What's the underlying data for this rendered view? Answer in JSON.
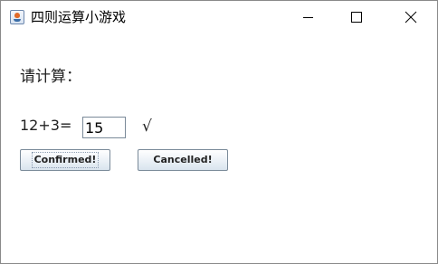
{
  "window": {
    "title": "四则运算小游戏",
    "icon": "java-coffee-icon"
  },
  "controls": {
    "minimize_icon": "minimize-icon",
    "maximize_icon": "maximize-icon",
    "close_icon": "close-icon"
  },
  "content": {
    "prompt": "请计算：",
    "question": "12+3=",
    "answer": "15",
    "result_mark": "√"
  },
  "buttons": {
    "confirm_label": "Confirmed!",
    "cancel_label": "Cancelled!"
  }
}
